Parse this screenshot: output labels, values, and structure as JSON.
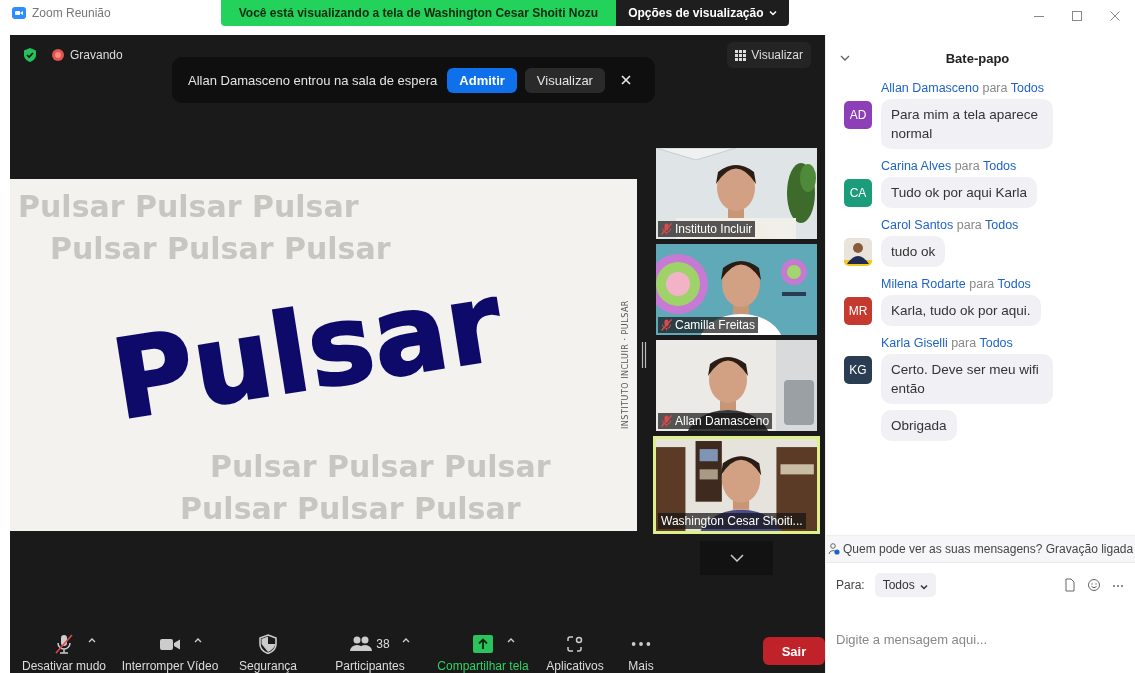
{
  "window": {
    "title": "Zoom Reunião"
  },
  "share_banner": {
    "text": "Você está visualizando a tela de Washington Cesar Shoiti Nozu",
    "options": "Opções de visualização"
  },
  "recording": {
    "label": "Gravando",
    "on": true
  },
  "view_button": {
    "label": "Visualizar"
  },
  "notification": {
    "text": "Allan Damasceno entrou na sala de espera",
    "buttons": [
      {
        "label": "Admitir",
        "primary": true
      },
      {
        "label": "Visualizar",
        "primary": false
      }
    ]
  },
  "slide": {
    "title": "Pulsar",
    "side_note": "INSTITUTO INCLUIR · PULSAR",
    "background_rows": [
      "Pulsar Pulsar Pulsar",
      "Pulsar Pulsar Pulsar",
      "Pulsar Pulsar Pulsar",
      "Pulsar Pulsar Pulsar"
    ]
  },
  "tiles": [
    {
      "name": "Instituto Incluir",
      "muted": true,
      "speaking": false
    },
    {
      "name": "Camilla Freitas",
      "muted": true,
      "speaking": false
    },
    {
      "name": "Allan Damasceno",
      "muted": true,
      "speaking": false
    },
    {
      "name": "Washington Cesar Shoiti...",
      "muted": false,
      "speaking": true
    }
  ],
  "toolbar": [
    {
      "kind": "mic",
      "label": "Desativar mudo",
      "muted": true,
      "caret": true,
      "highlight": false
    },
    {
      "kind": "video",
      "label": "Interromper Vídeo",
      "caret": true,
      "highlight": false
    },
    {
      "kind": "shield",
      "label": "Segurança",
      "caret": false,
      "highlight": false
    },
    {
      "kind": "people",
      "label": "Participantes",
      "count": "38",
      "caret": true,
      "highlight": false
    },
    {
      "kind": "share",
      "label": "Compartilhar tela",
      "caret": true,
      "highlight": true
    },
    {
      "kind": "apps",
      "label": "Aplicativos",
      "caret": false,
      "highlight": false
    },
    {
      "kind": "more",
      "label": "Mais",
      "caret": false,
      "highlight": false
    }
  ],
  "leave_button": {
    "label": "Sair"
  },
  "chat": {
    "title": "Bate-papo",
    "messages": [
      {
        "sender": "Allan Damasceno",
        "to_word": "para",
        "recipient": "Todos",
        "avatar": {
          "kind": "initials",
          "initials": "AD",
          "color": "#8c3fb6"
        },
        "bubbles": [
          "Para mim a tela aparece normal"
        ]
      },
      {
        "sender": "Carina Alves",
        "to_word": "para",
        "recipient": "Todos",
        "avatar": {
          "kind": "initials",
          "initials": "CA",
          "color": "#1b9c7a"
        },
        "bubbles": [
          "Tudo ok por aqui Karla"
        ]
      },
      {
        "sender": "Carol Santos",
        "to_word": "para",
        "recipient": "Todos",
        "avatar": {
          "kind": "picture"
        },
        "bubbles": [
          "tudo ok"
        ]
      },
      {
        "sender": "Milena Rodarte",
        "to_word": "para",
        "recipient": "Todos",
        "avatar": {
          "kind": "initials",
          "initials": "MR",
          "color": "#c6392e"
        },
        "bubbles": [
          "Karla, tudo ok por aqui."
        ]
      },
      {
        "sender": "Karla Giselli",
        "to_word": "para",
        "recipient": "Todos",
        "avatar": {
          "kind": "initials",
          "initials": "KG",
          "color": "#2b3d52"
        },
        "bubbles": [
          "Certo. Deve ser meu wifi então",
          "Obrigada"
        ]
      }
    ],
    "privacy_note": "Quem pode ver as suas mensagens? Gravação ligada",
    "to_label": "Para:",
    "to_value": "Todos",
    "placeholder": "Digite a mensagem aqui..."
  }
}
